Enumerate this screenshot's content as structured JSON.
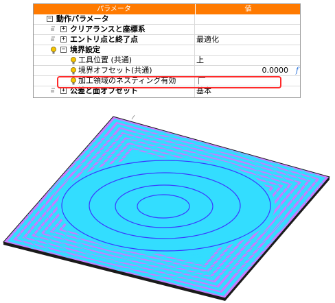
{
  "property_grid": {
    "header": {
      "name_col": "パラメータ",
      "value_col": "値"
    },
    "rows": [
      {
        "label": "動作パラメータ",
        "value": ""
      },
      {
        "label": "クリアランスと座標系",
        "value": ""
      },
      {
        "label": "エントリ点と終了点",
        "value": "最適化"
      },
      {
        "label": "境界設定",
        "value": ""
      },
      {
        "label": "工具位置 (共通)",
        "value": "上"
      },
      {
        "label": "境界オフセット(共通)",
        "value": "0.0000"
      },
      {
        "label": "加工領域のネスティング有効",
        "value": ""
      },
      {
        "label": "公差と面オフセット",
        "value": "基本"
      }
    ],
    "formula_icon": "f"
  },
  "icons": {
    "expand": "plus-box-icon",
    "collapse": "minus-box-icon",
    "parameter": "bulb-icon"
  },
  "colors": {
    "header_orange": "#ff7a00",
    "highlight_red": "#ff2a2a",
    "surface_cyan": "#33ddff",
    "toolpath_magenta": "#c77dff",
    "toolpath_blue": "#3a3aff"
  }
}
